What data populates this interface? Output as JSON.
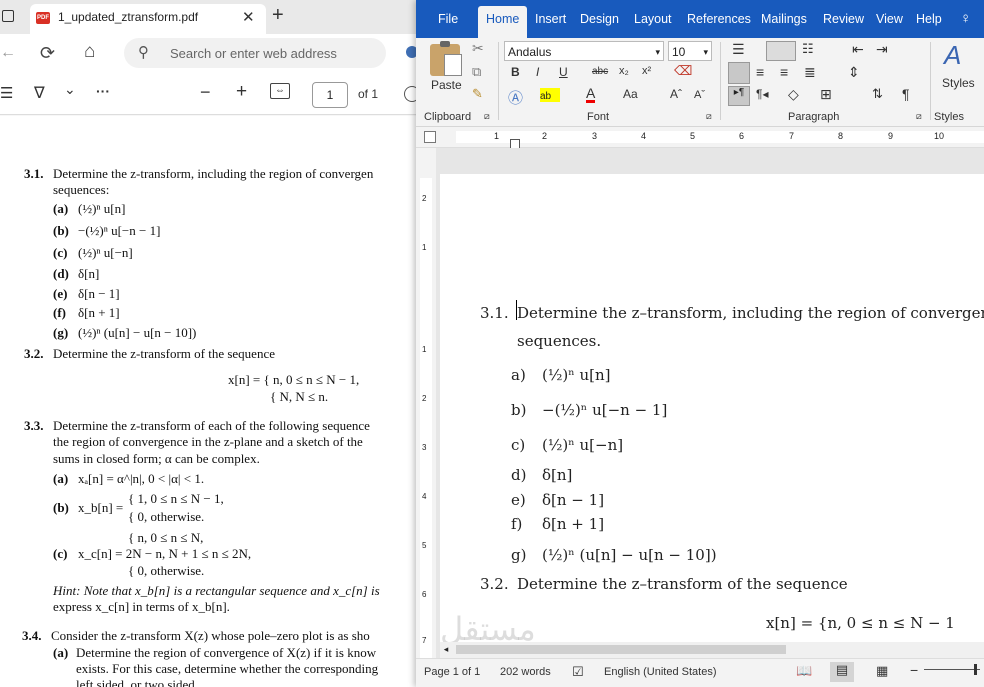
{
  "browser": {
    "tab_title": "1_updated_ztransform.pdf",
    "pdf_badge": "PDF",
    "close_glyph": "✕",
    "new_tab_glyph": "+",
    "back_glyph": "←",
    "reload_glyph": "⟳",
    "home_glyph": "⌂",
    "search_glyph": "⚲",
    "address_placeholder": "Search or enter web address",
    "pdf_toolbar": {
      "menu_glyph": "☰",
      "filter_glyph": "∇",
      "chevron_glyph": "⌄",
      "more_glyph": "···",
      "zoom_out_glyph": "−",
      "zoom_in_glyph": "+",
      "fit_glyph": "⇔",
      "page_number": "1",
      "page_of": "of 1"
    },
    "pdf_lines": [
      {
        "num": "3.1.",
        "text": "Determine the z-transform, including the region of convergen"
      },
      {
        "num": "",
        "text": "sequences:"
      },
      {
        "num": "(a)",
        "text": "(½)ⁿ u[n]"
      },
      {
        "num": "(b)",
        "text": "−(½)ⁿ u[−n − 1]"
      },
      {
        "num": "(c)",
        "text": "(½)ⁿ u[−n]"
      },
      {
        "num": "(d)",
        "text": "δ[n]"
      },
      {
        "num": "(e)",
        "text": "δ[n − 1]"
      },
      {
        "num": "(f)",
        "text": "δ[n + 1]"
      },
      {
        "num": "(g)",
        "text": "(½)ⁿ (u[n] − u[n − 10])"
      },
      {
        "num": "3.2.",
        "text": "Determine the z-transform of the sequence"
      },
      {
        "num": "",
        "text": "x[n] = { n,   0 ≤ n ≤ N − 1,"
      },
      {
        "num": "",
        "text": "{ N,   N ≤ n."
      },
      {
        "num": "3.3.",
        "text": "Determine the z-transform of each of the following sequence"
      },
      {
        "num": "",
        "text": "the region of convergence in the z-plane and a sketch of the"
      },
      {
        "num": "",
        "text": "sums in closed form; α can be complex."
      },
      {
        "num": "(a)",
        "text": "xₐ[n] = α^|n|,        0 < |α| < 1."
      },
      {
        "num": "",
        "text": "{ 1,   0 ≤ n ≤ N − 1,"
      },
      {
        "num": "(b)",
        "text": "x_b[n] ="
      },
      {
        "num": "",
        "text": "{ 0,   otherwise."
      },
      {
        "num": "",
        "text": "{ n,        0 ≤ n ≤ N,"
      },
      {
        "num": "(c)",
        "text": "x_c[n] =   2N − n,   N + 1 ≤ n ≤ 2N,"
      },
      {
        "num": "",
        "text": "{ 0,        otherwise."
      },
      {
        "num": "",
        "text": "Hint: Note that x_b[n] is a rectangular sequence and x_c[n] is"
      },
      {
        "num": "",
        "text": "express x_c[n] in terms of x_b[n]."
      },
      {
        "num": "3.4.",
        "text": "Consider the z-transform X(z) whose pole–zero plot is as sho"
      },
      {
        "num": "(a)",
        "text": "Determine the region of convergence of X(z) if it is know"
      },
      {
        "num": "",
        "text": "exists. For this case, determine whether the corresponding"
      },
      {
        "num": "",
        "text": "left sided, or two sided."
      }
    ]
  },
  "word": {
    "tabs": [
      "File",
      "Home",
      "Insert",
      "Design",
      "Layout",
      "References",
      "Mailings",
      "Review",
      "View",
      "Help"
    ],
    "active_tab": "Home",
    "lightbulb_glyph": "♀",
    "ribbon": {
      "paste_label": "Paste",
      "font_name": "Andalus",
      "font_size": "10",
      "bold": "B",
      "italic": "I",
      "underline": "U",
      "strike": "abc",
      "subscript": "x₂",
      "superscript": "x²",
      "font_color_a": "A",
      "change_case": "Aa",
      "grow_font": "Aˆ",
      "shrink_font": "Aˇ",
      "styles_label": "Styles",
      "groups": {
        "clipboard": "Clipboard",
        "font": "Font",
        "paragraph": "Paragraph",
        "styles": "Styles"
      }
    },
    "ruler_numbers": [
      "1",
      "2",
      "3",
      "4",
      "5",
      "6",
      "7",
      "8",
      "9",
      "10"
    ],
    "vruler_numbers": [
      "2",
      "1",
      "1",
      "2",
      "3",
      "4",
      "5",
      "6",
      "7"
    ],
    "document_lines": [
      {
        "num": "3.1.",
        "text": "Determine the z–transform, including the region of convergence, f"
      },
      {
        "num": "",
        "text": "sequences."
      },
      {
        "num": "a)",
        "text": "(½)ⁿ u[n]"
      },
      {
        "num": "b)",
        "text": "−(½)ⁿ u[−n − 1]"
      },
      {
        "num": "c)",
        "text": "(½)ⁿ u[−n]"
      },
      {
        "num": "d)",
        "text": "δ[n]"
      },
      {
        "num": "e)",
        "text": "δ[n − 1]"
      },
      {
        "num": "f)",
        "text": "δ[n + 1]"
      },
      {
        "num": "g)",
        "text": "(½)ⁿ (u[n] − u[n − 10])"
      },
      {
        "num": "3.2.",
        "text": "Determine the z–transform of the sequence"
      },
      {
        "num": "",
        "text": "x[n] = {n,   0 ≤ n ≤ N − 1"
      }
    ],
    "status": {
      "page": "Page 1 of 1",
      "words": "202 words",
      "proofing_glyph": "☑",
      "language": "English (United States)",
      "read_mode_glyph": "📖",
      "print_layout_glyph": "▤",
      "web_layout_glyph": "▦",
      "zoom_minus": "−"
    },
    "watermark": "مستقل"
  },
  "colors": {
    "word_blue": "#185abd",
    "pdf_red": "#d93025"
  }
}
